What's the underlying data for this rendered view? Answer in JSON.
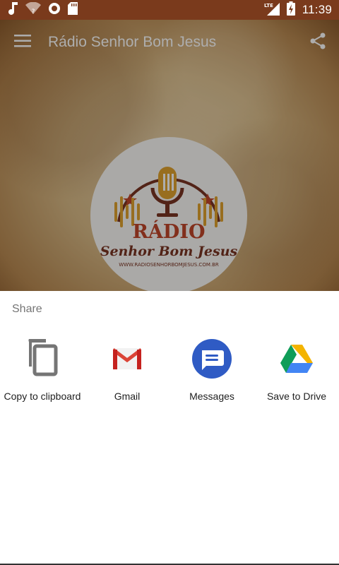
{
  "status_bar": {
    "time": "11:39",
    "network": "LTE",
    "icons": [
      "music-note-icon",
      "wifi-question-icon",
      "record-icon",
      "sd-card-icon",
      "lte-signal-icon",
      "battery-charging-icon"
    ]
  },
  "app": {
    "title": "Rádio Senhor Bom Jesus",
    "logo": {
      "line1": "RÁDIO",
      "line2": "Senhor Bom Jesus",
      "website": "WWW.RADIOSENHORBOMJESUS.COM.BR"
    }
  },
  "share_sheet": {
    "title": "Share",
    "targets": [
      {
        "label": "Copy to clipboard",
        "icon": "copy-icon"
      },
      {
        "label": "Gmail",
        "icon": "gmail-icon"
      },
      {
        "label": "Messages",
        "icon": "messages-icon"
      },
      {
        "label": "Save to Drive",
        "icon": "drive-icon"
      }
    ]
  },
  "colors": {
    "status_bar": "#7a3a1c",
    "gmail_red": "#db4437",
    "messages_blue": "#2f5bc4",
    "drive_green": "#0f9d58",
    "drive_yellow": "#f4b400",
    "drive_blue": "#4285f4"
  }
}
